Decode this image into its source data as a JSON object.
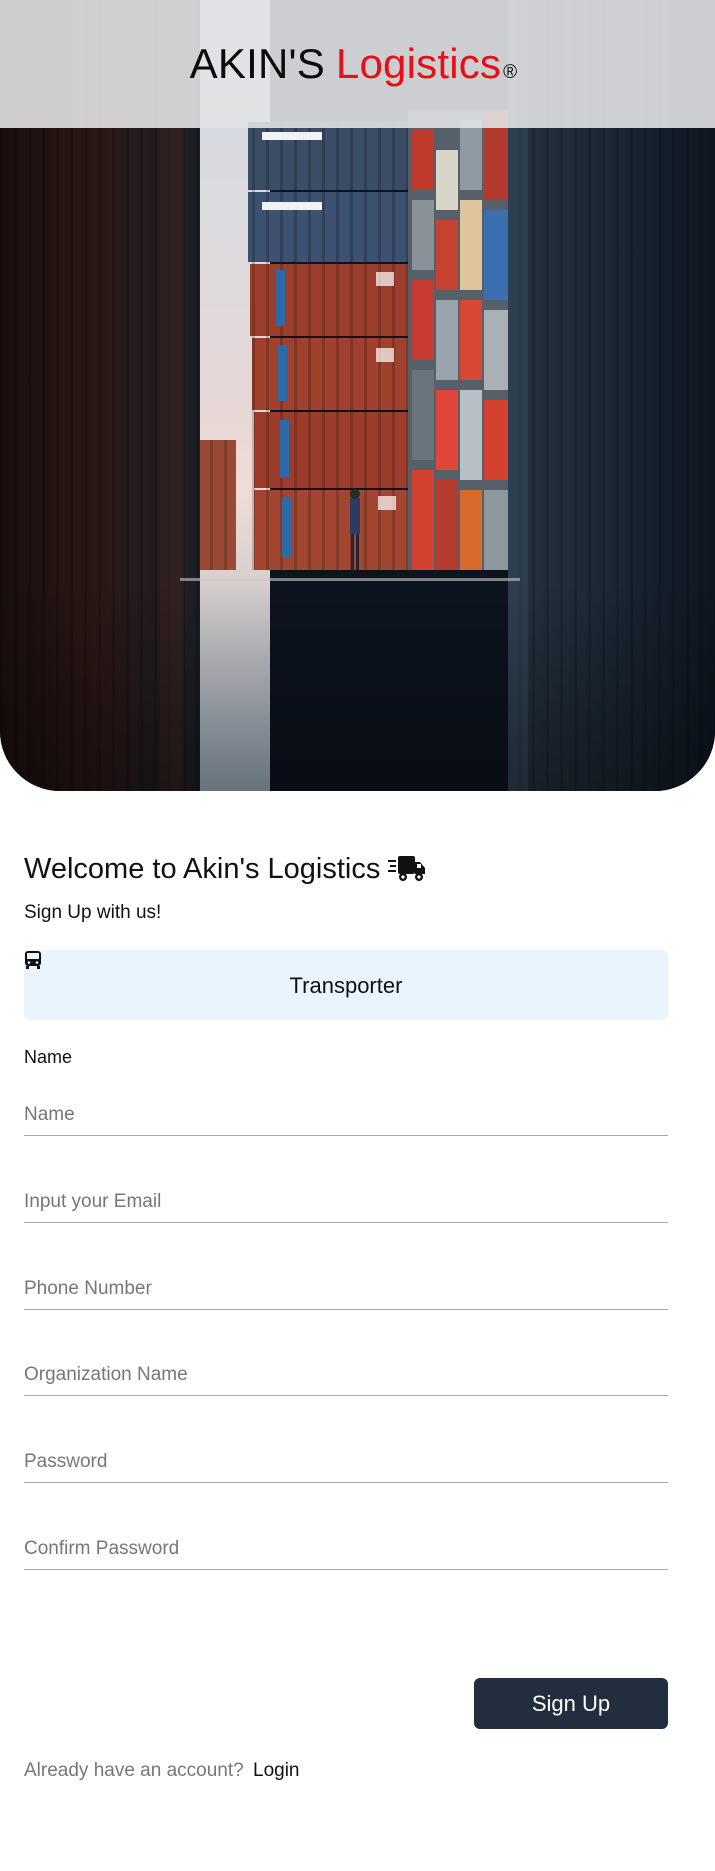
{
  "brand": {
    "name_part1": "AKIN'S",
    "name_part2": "Logistics",
    "registered_mark": "®",
    "accent_color": "#e60f14"
  },
  "hero": {
    "image": "shipping containers stacked with reflection in water"
  },
  "form": {
    "title": "Welcome to Akin's Logistics",
    "title_icon": "truck-fast-icon",
    "subtitle": "Sign Up with us!",
    "role": {
      "icon": "bus-icon",
      "label": "Transporter",
      "background": "#e9f4fd"
    },
    "name_caption": "Name",
    "fields": {
      "name": {
        "placeholder": "Name",
        "value": ""
      },
      "email": {
        "placeholder": "Input your Email",
        "value": ""
      },
      "phone": {
        "placeholder": "Phone Number",
        "value": ""
      },
      "organization": {
        "placeholder": "Organization Name",
        "value": ""
      },
      "password": {
        "placeholder": "Password",
        "value": ""
      },
      "confirm_password": {
        "placeholder": "Confirm Password",
        "value": ""
      }
    },
    "submit_label": "Sign Up",
    "submit_color": "#222d3d",
    "login_prompt": "Already have an account?",
    "login_link": "Login"
  }
}
